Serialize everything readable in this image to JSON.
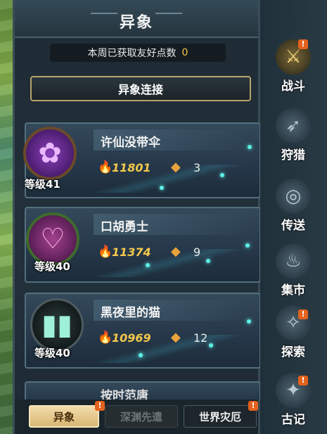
{
  "header": {
    "title": "异象"
  },
  "friend_points": {
    "label": "本周已获取友好点数",
    "value": "0"
  },
  "link_button": {
    "label": "异象连接"
  },
  "entries": [
    {
      "name": "许仙没带伞",
      "power": "11801",
      "count": "3",
      "level": "等级41",
      "avatar_icon": "rose-icon"
    },
    {
      "name": "口胡勇士",
      "power": "11374",
      "count": "9",
      "level": "等级40",
      "avatar_icon": "hearts-icon"
    },
    {
      "name": "黑夜里的猫",
      "power": "10969",
      "count": "12",
      "level": "等级40",
      "avatar_icon": "book-icon"
    },
    {
      "name": "按时范唐"
    }
  ],
  "tabs": [
    {
      "label": "异象",
      "state": "active",
      "badge": "!"
    },
    {
      "label": "深渊先遣",
      "state": "locked"
    },
    {
      "label": "世界灾厄",
      "state": "normal",
      "badge": "!"
    }
  ],
  "sidebar": [
    {
      "label": "战斗",
      "icon": "sword-icon",
      "badge": "!",
      "active": true
    },
    {
      "label": "狩猎",
      "icon": "bow-icon"
    },
    {
      "label": "传送",
      "icon": "portal-icon"
    },
    {
      "label": "集市",
      "icon": "bag-icon"
    },
    {
      "label": "探索",
      "icon": "horn-icon",
      "badge": "!"
    },
    {
      "label": "古记",
      "icon": "compass-icon",
      "badge": "!"
    }
  ],
  "colors": {
    "power": "#f3c84a",
    "accent_gold": "#b9a36a",
    "badge": "#e4621d",
    "dot": "#5ef0e6"
  }
}
